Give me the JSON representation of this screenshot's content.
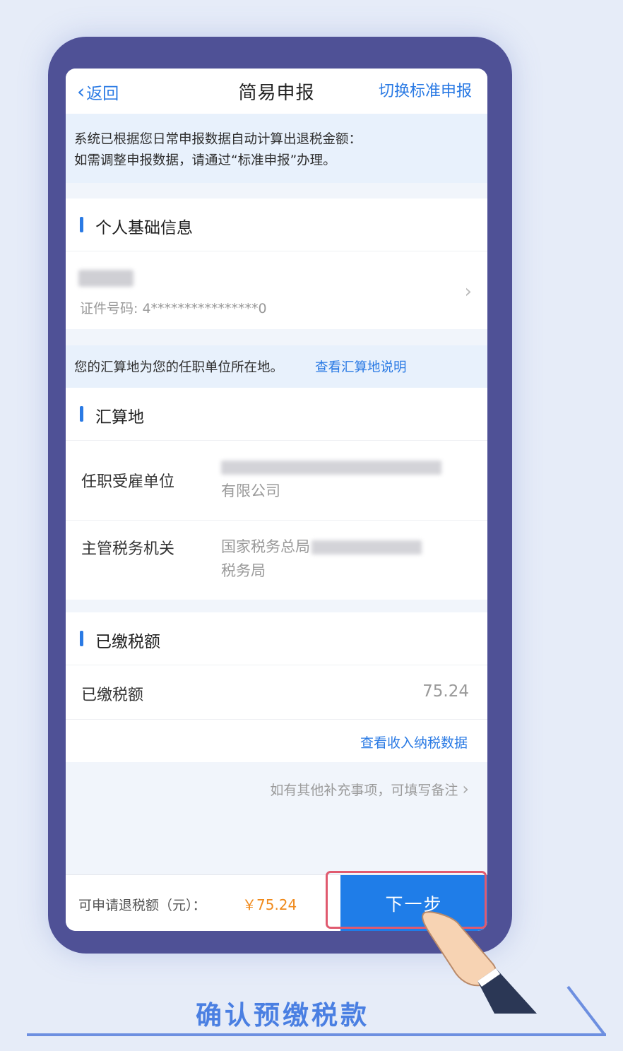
{
  "nav": {
    "back_label": "返回",
    "title": "简易申报",
    "switch_label": "切换标准申报"
  },
  "notice": {
    "line1": "系统已根据您日常申报数据自动计算出退税金额：",
    "line2": "如需调整申报数据，请通过“标准申报”办理。"
  },
  "personal": {
    "section_title": "个人基础信息",
    "id_label": "证件号码: 4****************0"
  },
  "tip": {
    "text": "您的汇算地为您的任职单位所在地。",
    "link": "查看汇算地说明"
  },
  "settlement": {
    "section_title": "汇算地",
    "employer_label": "任职受雇单位",
    "employer_value_suffix": "有限公司",
    "tax_office_label": "主管税务机关",
    "tax_office_prefix": "国家税务总局",
    "tax_office_suffix": "税务局"
  },
  "paid": {
    "section_title": "已缴税额",
    "row_label": "已缴税额",
    "row_value": "75.24",
    "link": "查看收入纳税数据"
  },
  "remark": {
    "text": "如有其他补充事项，可填写备注"
  },
  "footer": {
    "refund_label": "可申请退税额（元）：",
    "refund_amount": "￥75.24",
    "next_button": "下一步"
  },
  "caption": "确认预缴税款",
  "colors": {
    "accent": "#1f7de8",
    "frame": "#4f5196",
    "amount": "#f08a1c",
    "highlight": "#e05a6f"
  }
}
